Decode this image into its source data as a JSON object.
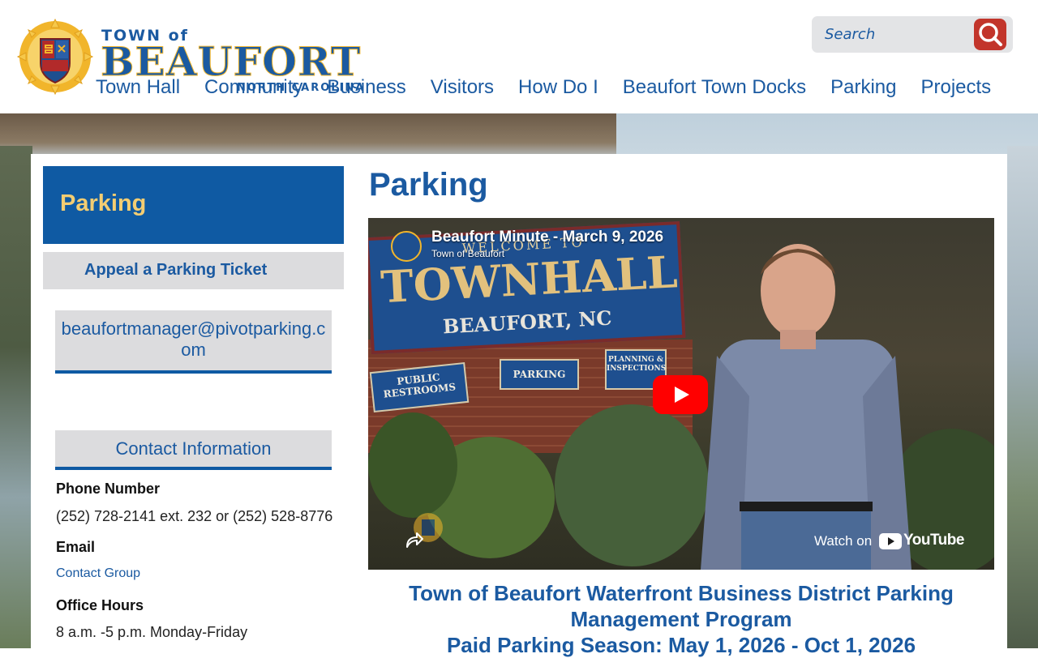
{
  "header": {
    "logo": {
      "town": "TOWN of",
      "name": "BEAUFORT",
      "state": "NORTH CAROLINA"
    },
    "search": {
      "placeholder": "Search"
    },
    "nav": [
      "Town Hall",
      "Community",
      "Business",
      "Visitors",
      "How Do I",
      "Beaufort Town Docks",
      "Parking",
      "Projects"
    ]
  },
  "sidebar": {
    "title": "Parking",
    "link": "Appeal a Parking Ticket",
    "email": "beaufortmanager@pivotparking.com",
    "contact": {
      "heading": "Contact Information",
      "phone_label": "Phone Number",
      "phone_value": "(252) 728-2141 ext. 232 or (252) 528-8776",
      "email_label": "Email",
      "email_link": "Contact Group",
      "hours_label": "Office Hours",
      "hours_value": "8 a.m. -5 p.m. Monday-Friday"
    }
  },
  "main": {
    "title": "Parking",
    "video": {
      "title": "Beaufort Minute - March 9, 2026",
      "channel": "Town of Beaufort",
      "watch_on": "Watch on",
      "brand": "YouTube",
      "scene": {
        "sign_welcome": "WELCOME TO",
        "sign_townhall": "TOWNHALL",
        "sign_place": "BEAUFORT, NC",
        "sign_restrooms_1": "PUBLIC",
        "sign_restrooms_2": "RESTROOMS",
        "sign_parking": "PARKING",
        "sign_planning_1": "PLANNING &",
        "sign_planning_2": "INSPECTIONS"
      }
    },
    "headline_1": "Town of Beaufort Waterfront Business District Parking",
    "headline_2": "Management Program",
    "headline_3": "Paid Parking Season: May 1, 2026 - Oct 1, 2026"
  },
  "colors": {
    "brand_blue": "#1b5aa1",
    "sidebar_blue": "#0f5aa3",
    "gold": "#f3cd72",
    "search_red": "#c2352b",
    "youtube_red": "#ff0000"
  }
}
